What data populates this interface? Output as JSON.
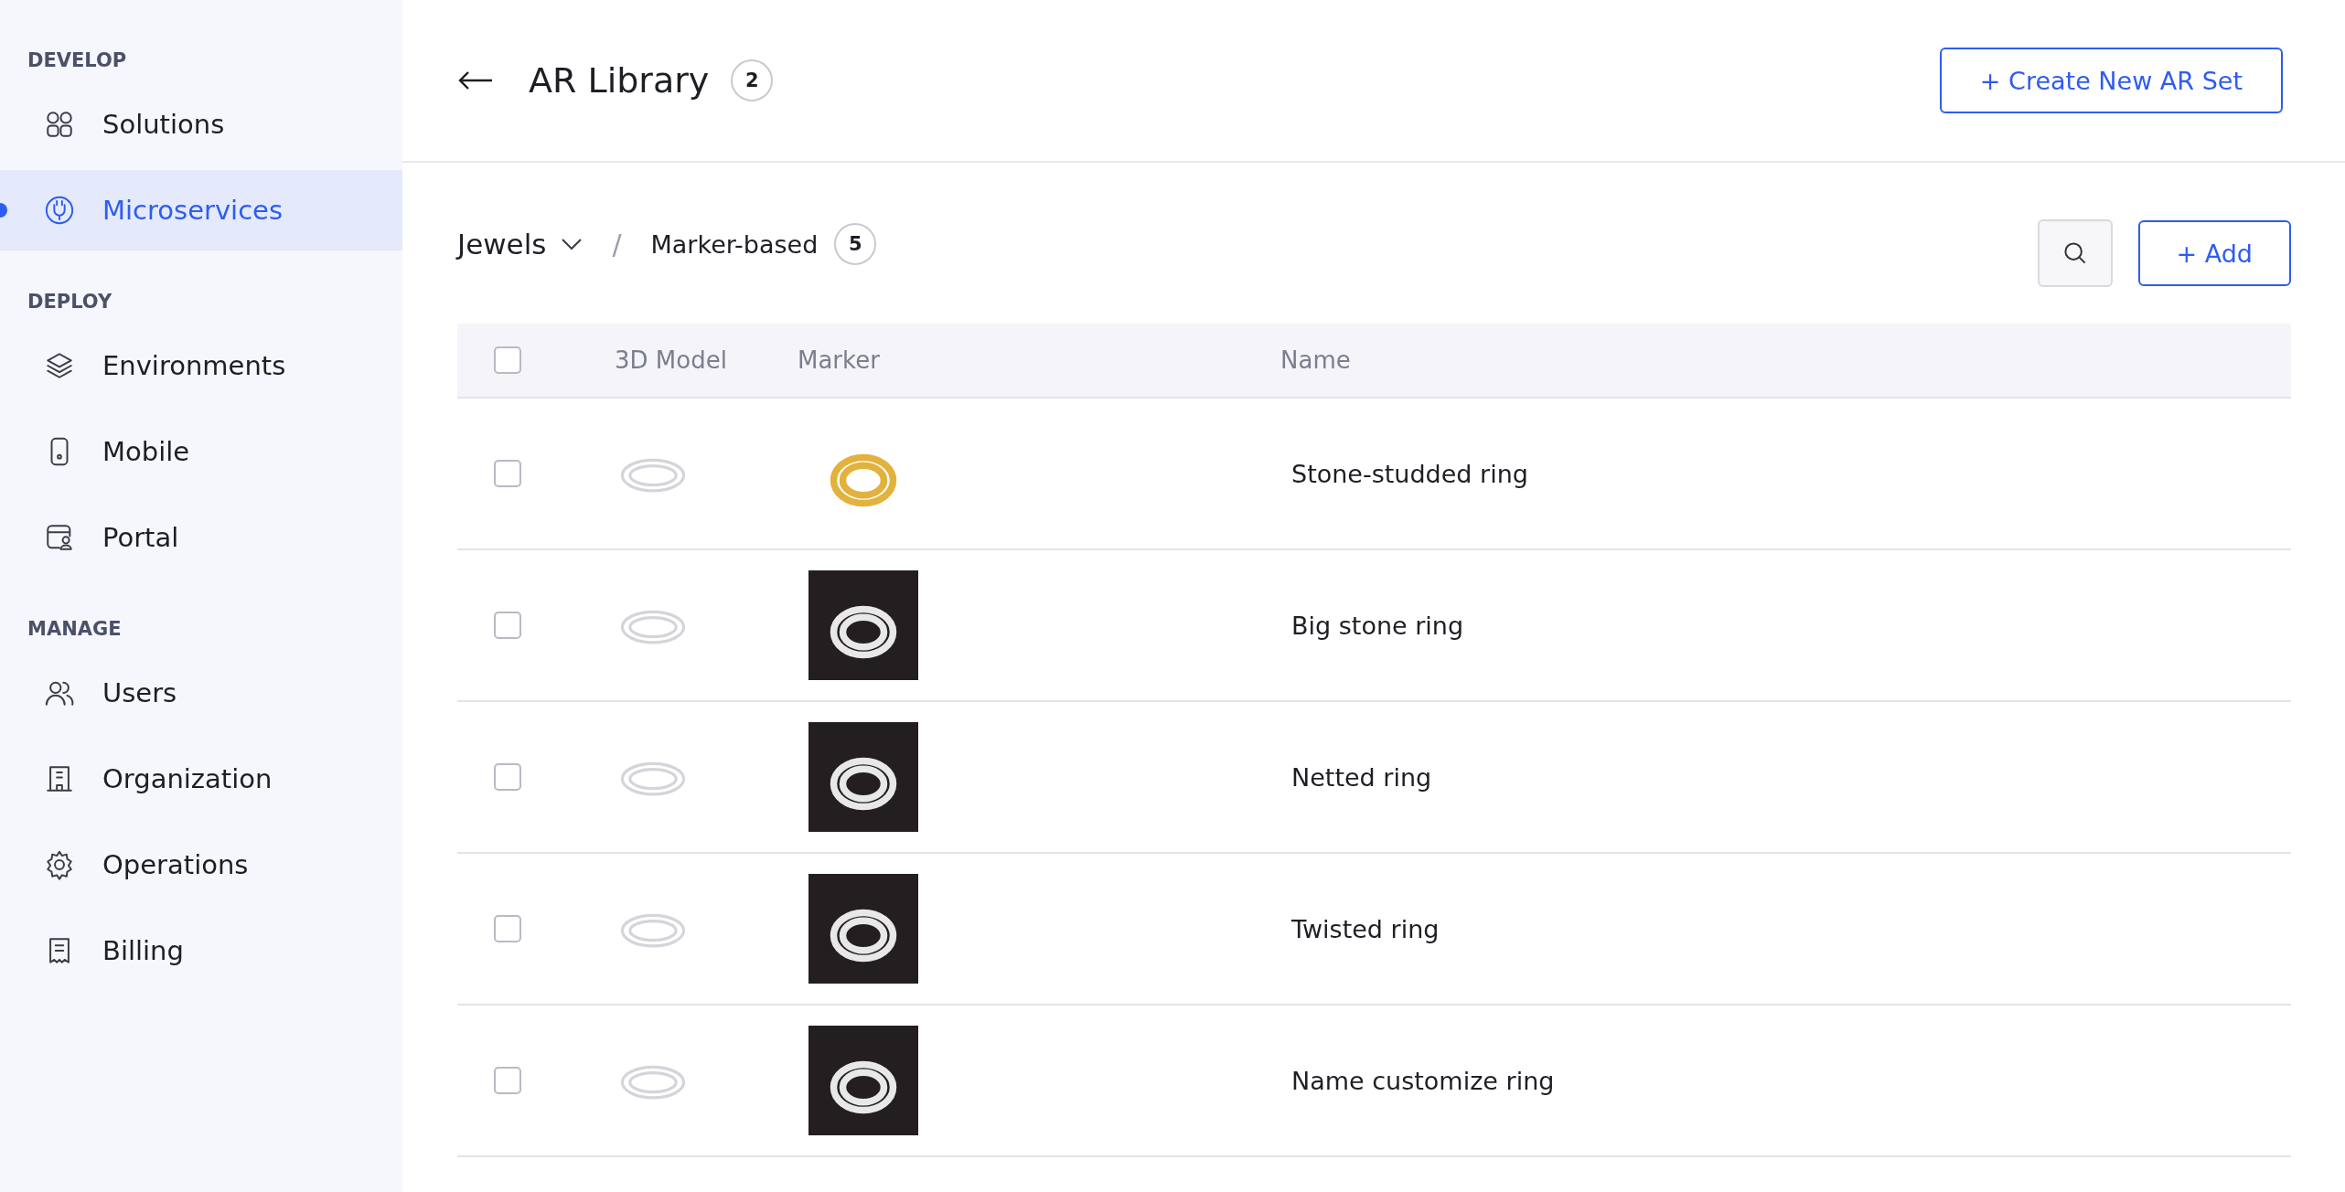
{
  "sidebar": {
    "sections": [
      {
        "heading": "DEVELOP",
        "items": [
          {
            "label": "Solutions",
            "selected": false
          },
          {
            "label": "Microservices",
            "selected": true
          }
        ]
      },
      {
        "heading": "DEPLOY",
        "items": [
          {
            "label": "Environments",
            "selected": false
          },
          {
            "label": "Mobile",
            "selected": false
          },
          {
            "label": "Portal",
            "selected": false
          }
        ]
      },
      {
        "heading": "MANAGE",
        "items": [
          {
            "label": "Users",
            "selected": false
          },
          {
            "label": "Organization",
            "selected": false
          },
          {
            "label": "Operations",
            "selected": false
          },
          {
            "label": "Billing",
            "selected": false
          }
        ]
      }
    ]
  },
  "header": {
    "title": "AR Library",
    "count": "2",
    "create_button": "+ Create New AR Set"
  },
  "breadcrumb": {
    "category": "Jewels",
    "separator": "/",
    "current": "Marker-based",
    "count": "5"
  },
  "add_button": "+ Add",
  "table": {
    "select_all_checked": false,
    "columns": [
      "3D Model",
      "Marker",
      "Name"
    ],
    "rows": [
      {
        "checked": false,
        "marker_dark": false,
        "name": "Stone-studded ring"
      },
      {
        "checked": false,
        "marker_dark": true,
        "name": "Big stone ring"
      },
      {
        "checked": false,
        "marker_dark": true,
        "name": "Netted ring"
      },
      {
        "checked": false,
        "marker_dark": true,
        "name": "Twisted ring"
      },
      {
        "checked": false,
        "marker_dark": true,
        "name": "Name customize ring"
      }
    ]
  }
}
